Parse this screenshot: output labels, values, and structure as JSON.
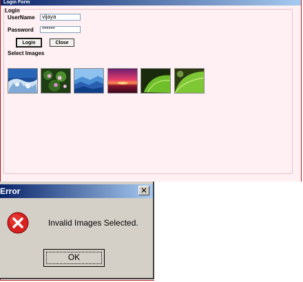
{
  "window": {
    "title": "Login Form"
  },
  "form": {
    "group_title": "Login",
    "username_label": "UserName",
    "username_value": "vijaya",
    "password_label": "Password",
    "password_value": "******",
    "login_button": "Login",
    "close_button": "Close",
    "select_images_label": "Select Images",
    "images": [
      {
        "name": "frosted-tree-image"
      },
      {
        "name": "flower-bush-image"
      },
      {
        "name": "blue-mountains-image"
      },
      {
        "name": "sunset-image"
      },
      {
        "name": "green-leaf-image"
      },
      {
        "name": "green-leaf-closeup-image"
      }
    ]
  },
  "dialog": {
    "title": "Error",
    "close_glyph": "✕",
    "message": "Invalid Images Selected.",
    "ok_button": "OK",
    "icon": "error-icon"
  },
  "colors": {
    "form_background": "#fff0f3",
    "titlebar_start": "#0a246a",
    "titlebar_end": "#a6caf0",
    "dialog_background": "#d4d0c8",
    "error_red": "#d8201e"
  }
}
